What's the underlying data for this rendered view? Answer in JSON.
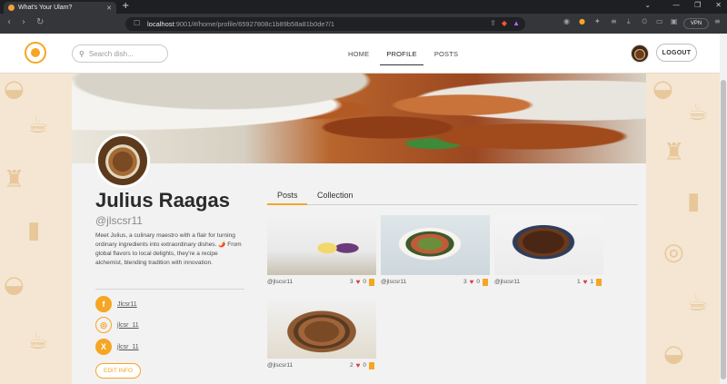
{
  "browser": {
    "tab_title": "What's Your Ulam?",
    "url_host": "localhost",
    "url_rest": ":9001/#/home/profile/65927808c1b89b58a81b0de7/1",
    "vpn_label": "VPN"
  },
  "header": {
    "search_placeholder": "Search dish...",
    "nav": [
      "HOME",
      "PROFILE",
      "POSTS"
    ],
    "logout_label": "LOGOUT"
  },
  "profile": {
    "name": "Julius Raagas",
    "handle": "@jlscsr11",
    "bio": "Meet Julius, a culinary maestro with a flair for turning ordinary ingredients into extraordinary dishes. 🌶️ From global flavors to local delights, they're a recipe alchemist, blending tradition with innovation.",
    "socials": [
      {
        "icon": "facebook-icon",
        "label": "Jlcsr11"
      },
      {
        "icon": "instagram-icon",
        "label": "jlcsr_11"
      },
      {
        "icon": "x-icon",
        "label": "jlcsr_11"
      }
    ],
    "edit_label": "EDIT INFO"
  },
  "tabs": [
    "Posts",
    "Collection"
  ],
  "posts": [
    {
      "author": "@jlscsr11",
      "likes": "3",
      "saves": "0",
      "image": "smoothie-photo"
    },
    {
      "author": "@jlscsr11",
      "likes": "3",
      "saves": "0",
      "image": "noodle-salad-photo"
    },
    {
      "author": "@jlscsr11",
      "likes": "1",
      "saves": "1",
      "image": "shredded-beef-photo"
    },
    {
      "author": "@jlscsr11",
      "likes": "2",
      "saves": "0",
      "image": "beef-stew-photo"
    }
  ],
  "colors": {
    "accent": "#f5a623",
    "heart": "#e23b3b",
    "pattern_bg": "#f4e6d2"
  }
}
